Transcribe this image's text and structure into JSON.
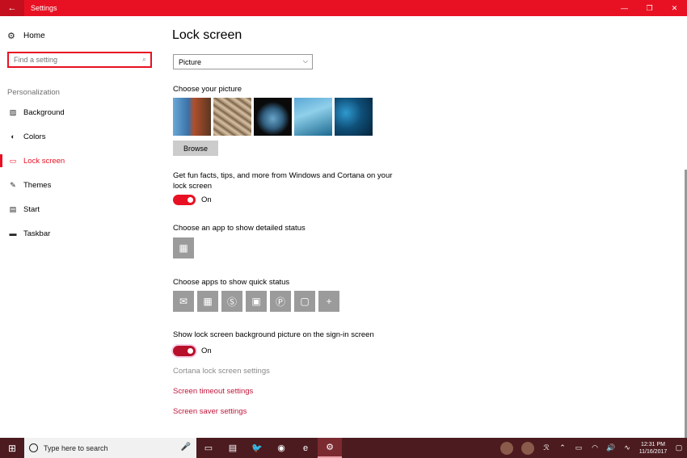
{
  "window": {
    "title": "Settings",
    "back_glyph": "←",
    "min_glyph": "—",
    "max_glyph": "❐",
    "close_glyph": "✕"
  },
  "sidebar": {
    "home_label": "Home",
    "home_icon": "⚙",
    "search_placeholder": "Find a setting",
    "search_icon": "⌕",
    "section_title": "Personalization",
    "items": [
      {
        "label": "Background",
        "icon": "▨"
      },
      {
        "label": "Colors",
        "icon": "◐"
      },
      {
        "label": "Lock screen",
        "icon": "▭"
      },
      {
        "label": "Themes",
        "icon": "✎"
      },
      {
        "label": "Start",
        "icon": "▤"
      },
      {
        "label": "Taskbar",
        "icon": "▬"
      }
    ],
    "active_index": 2
  },
  "main": {
    "title": "Lock screen",
    "background_dropdown": {
      "value": "Picture",
      "chevron": "⌵"
    },
    "choose_picture_label": "Choose your picture",
    "browse_label": "Browse",
    "fun_facts_label_line1": "Get fun facts, tips, and more from Windows and Cortana on your",
    "fun_facts_label_line2": "lock screen",
    "fun_facts_state": "On",
    "detailed_status_label": "Choose an app to show detailed status",
    "detailed_status_app_icon": "▦",
    "quick_status_label": "Choose apps to show quick status",
    "quick_status_apps": [
      "✉",
      "▦",
      "Ⓢ",
      "▣",
      "Ⓟ",
      "▢",
      "+"
    ],
    "signin_bg_label": "Show lock screen background picture on the sign-in screen",
    "signin_bg_state": "On",
    "cortana_link": "Cortana lock screen settings",
    "timeout_link": "Screen timeout settings",
    "saver_link": "Screen saver settings"
  },
  "taskbar": {
    "start_glyph": "⊞",
    "search_text": "Type here to search",
    "mic_glyph": "🎤",
    "apps": [
      "▭",
      "▤",
      "🐦",
      "◉",
      "e",
      "⚙"
    ],
    "tray_icons": [
      "⌃",
      "▭",
      "◠",
      "🔊",
      "∿"
    ],
    "people_glyph": "ℛ",
    "time": "12:31 PM",
    "date": "11/16/2017",
    "notification_glyph": "▢"
  }
}
